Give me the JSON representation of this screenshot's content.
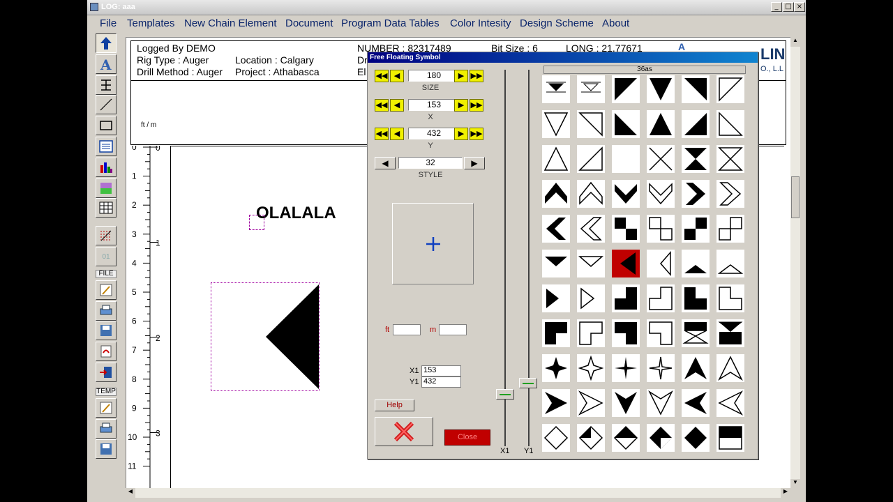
{
  "window": {
    "title": "LOG: aaa",
    "buttons": [
      "_",
      "□",
      "×"
    ]
  },
  "menu": [
    "File",
    "Templates",
    "New Chain Element",
    "Document",
    "Program Data Tables",
    "Color Intesity",
    "Design Scheme",
    "About"
  ],
  "toolbar": {
    "label_file": "FILE",
    "label_temp": "TEMP",
    "label_01": "01"
  },
  "header": {
    "logged_by": "Logged By DEMO",
    "rig_type": "Rig Type : Auger",
    "drill_method": "Drill Method : Auger",
    "location": "Location : Calgary",
    "project": "Project : Athabasca",
    "number": "NUMBER : 82317489",
    "dr1": "Dr",
    "dr2": "Dr",
    "el": "El",
    "bit_size": "Bit Size : 6",
    "long": "LONG : 21.77671",
    "letter_a": "A",
    "logo_partial": "LIN",
    "logo_sub": "O., L.L"
  },
  "units_label": "ft / m",
  "ruler": {
    "ft": [
      "0",
      "1",
      "2",
      "3",
      "4",
      "5",
      "6",
      "7",
      "8",
      "9",
      "10",
      "11"
    ],
    "m": [
      "0",
      "1",
      "2",
      "3"
    ]
  },
  "canvas_text": "OLALALA",
  "dialog": {
    "title": "Free Floating Symbol",
    "size": {
      "value": "180",
      "label": "SIZE"
    },
    "x": {
      "value": "153",
      "label": "X"
    },
    "y": {
      "value": "432",
      "label": "Y"
    },
    "style": {
      "value": "32",
      "label": "STYLE"
    },
    "ft_label": "ft",
    "m_label": "m",
    "x1_label": "X1",
    "x1_value": "153",
    "y1_label": "Y1",
    "y1_value": "432",
    "help": "Help",
    "close": "Close",
    "slider_x1": "X1",
    "slider_y1": "Y1",
    "grid_header": "36as",
    "selected_index": 32
  }
}
